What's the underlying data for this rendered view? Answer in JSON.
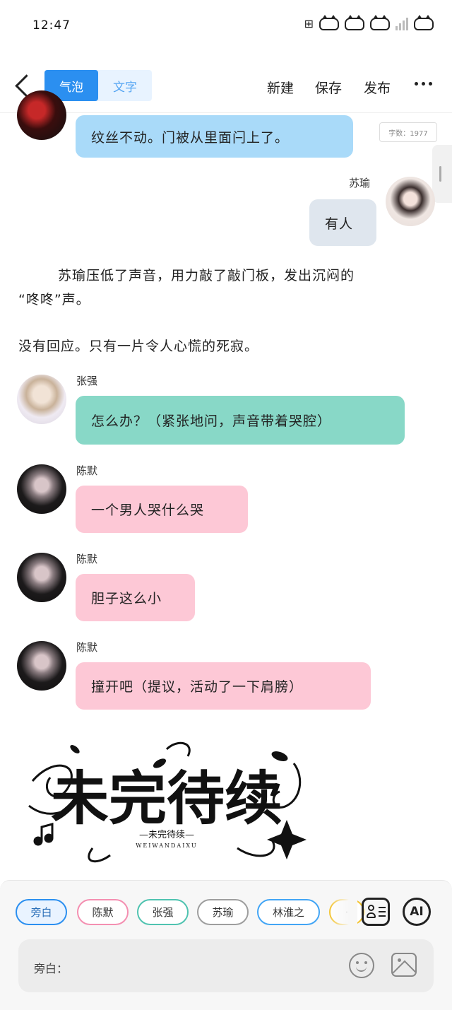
{
  "status_bar": {
    "time": "12:47"
  },
  "nav": {
    "tab_bubble": "气泡",
    "tab_text": "文字",
    "new_label": "新建",
    "save_label": "保存",
    "publish_label": "发布"
  },
  "editor": {
    "word_count": "字数：1977",
    "messages": [
      {
        "speaker": "",
        "text": "纹丝不动。门被从里面闩上了。",
        "color": "#a9daf9"
      },
      {
        "speaker": "苏瑜",
        "text": "有人",
        "color": "#dfe6ee"
      },
      {
        "speaker": "张强",
        "text": "怎么办？（紧张地问，声音带着哭腔）",
        "color": "#88d8c7"
      },
      {
        "speaker": "陈默",
        "text": "一个男人哭什么哭",
        "color": "#fdc8d6"
      },
      {
        "speaker": "陈默",
        "text": "胆子这么小",
        "color": "#fdc8d6"
      },
      {
        "speaker": "陈默",
        "text": "撞开吧（提议，活动了一下肩膀）",
        "color": "#fdc8d6"
      }
    ],
    "narration_1_line1": "苏瑜压低了声音，用力敲了敲门板，发出沉闷的",
    "narration_1_line2": "“咚咚”声。",
    "narration_2": "没有回应。只有一片令人心慌的死寂。",
    "logo": {
      "title": "未完待续",
      "subtitle": "—未完待续—",
      "pinyin": "WEIWANDAIXU"
    }
  },
  "bottom": {
    "chips": [
      {
        "label": "旁白",
        "color": "#2b8ff0"
      },
      {
        "label": "陈默",
        "color": "#f48fb1"
      },
      {
        "label": "张强",
        "color": "#4fc3b0"
      },
      {
        "label": "苏瑜",
        "color": "#9e9e9e"
      },
      {
        "label": "林淮之",
        "color": "#42a5f5"
      },
      {
        "label": "·",
        "color": "#f4c430"
      }
    ],
    "ai_label": "AI",
    "input_label": "旁白："
  }
}
